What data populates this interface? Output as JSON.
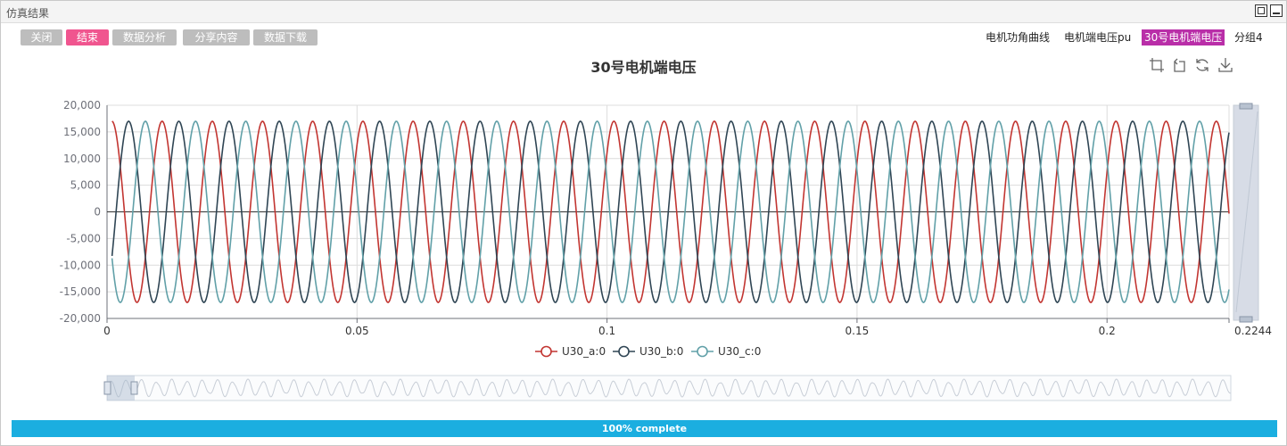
{
  "window": {
    "title": "仿真结果"
  },
  "toolbar": {
    "buttons": [
      {
        "label": "关闭",
        "active": false
      },
      {
        "label": "结束",
        "active": true
      },
      {
        "label": "数据分析",
        "active": false
      },
      {
        "label": "分享内容",
        "active": false
      },
      {
        "label": "数据下载",
        "active": false
      }
    ]
  },
  "tabs": [
    {
      "label": "电机功角曲线",
      "active": false
    },
    {
      "label": "电机端电压pu",
      "active": false
    },
    {
      "label": "30号电机端电压",
      "active": true
    },
    {
      "label": "分组4",
      "active": false
    }
  ],
  "toolbox_icons": [
    "zoom-select-icon",
    "zoom-reset-icon",
    "restore-icon",
    "save-image-icon"
  ],
  "progress": {
    "label": "100% complete",
    "percent": 100
  },
  "chart_data": {
    "type": "line",
    "title": "30号电机端电压",
    "xlabel": "",
    "ylabel": "",
    "xlim": [
      0,
      0.2244
    ],
    "ylim": [
      -20000,
      20000
    ],
    "x_ticks": [
      "0",
      "0.05",
      "0.1",
      "0.15",
      "0.2",
      "0.2244"
    ],
    "y_ticks": [
      "-20,000",
      "-15,000",
      "-10,000",
      "-5,000",
      "0",
      "5,000",
      "10,000",
      "15,000",
      "20,000"
    ],
    "grid": true,
    "legend_position": "bottom",
    "waveform": {
      "amplitude": 17000,
      "frequency_hz": 99.6,
      "x_start": 0.001,
      "x_end": 0.2244
    },
    "series": [
      {
        "name": "U30_a:0",
        "color": "#c23531",
        "phase_deg": 55
      },
      {
        "name": "U30_b:0",
        "color": "#2f4554",
        "phase_deg": -65
      },
      {
        "name": "U30_c:0",
        "color": "#61a0a8",
        "phase_deg": 175
      }
    ],
    "data_zoom": {
      "start_percent": 0,
      "end_percent": 100
    }
  }
}
